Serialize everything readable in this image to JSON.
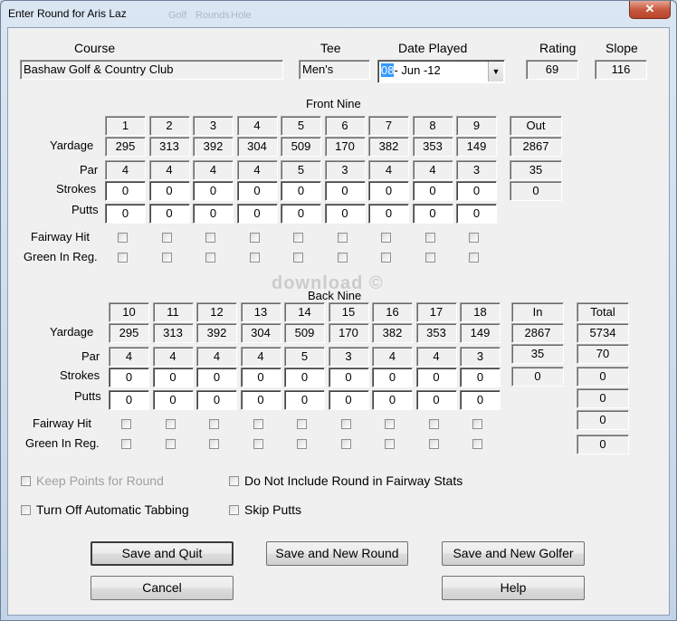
{
  "window": {
    "title": "Enter Round for Aris Laz",
    "close_glyph": "✕",
    "background_menu_ghost": [
      "Golf",
      "Rounds",
      "Hole"
    ]
  },
  "header": {
    "course_label": "Course",
    "course_value": "Bashaw Golf & Country Club",
    "tee_label": "Tee",
    "tee_value": "Men's",
    "date_label": "Date Played",
    "date_day": "08",
    "date_rest": "- Jun -12",
    "rating_label": "Rating",
    "rating_value": "69",
    "slope_label": "Slope",
    "slope_value": "116"
  },
  "front": {
    "title": "Front Nine",
    "holes": [
      "1",
      "2",
      "3",
      "4",
      "5",
      "6",
      "7",
      "8",
      "9"
    ],
    "yardage": [
      "295",
      "313",
      "392",
      "304",
      "509",
      "170",
      "382",
      "353",
      "149"
    ],
    "par": [
      "4",
      "4",
      "4",
      "4",
      "5",
      "3",
      "4",
      "4",
      "3"
    ],
    "strokes": [
      "0",
      "0",
      "0",
      "0",
      "0",
      "0",
      "0",
      "0",
      "0"
    ],
    "putts": [
      "0",
      "0",
      "0",
      "0",
      "0",
      "0",
      "0",
      "0",
      "0"
    ],
    "sum_label": "Out",
    "sum_yardage": "2867",
    "sum_par": "35",
    "sum_strokes": "0"
  },
  "back": {
    "title": "Back Nine",
    "holes": [
      "10",
      "11",
      "12",
      "13",
      "14",
      "15",
      "16",
      "17",
      "18"
    ],
    "yardage": [
      "295",
      "313",
      "392",
      "304",
      "509",
      "170",
      "382",
      "353",
      "149"
    ],
    "par": [
      "4",
      "4",
      "4",
      "4",
      "5",
      "3",
      "4",
      "4",
      "3"
    ],
    "strokes": [
      "0",
      "0",
      "0",
      "0",
      "0",
      "0",
      "0",
      "0",
      "0"
    ],
    "putts": [
      "0",
      "0",
      "0",
      "0",
      "0",
      "0",
      "0",
      "0",
      "0"
    ],
    "sum_label": "In",
    "sum_yardage": "2867",
    "sum_par": "35",
    "sum_strokes": "0",
    "total_label": "Total",
    "total_yardage": "5734",
    "total_par": "70",
    "total_strokes": "0",
    "total_putts": "0",
    "total_fairway": "0",
    "total_gir": "0"
  },
  "row_labels": {
    "yardage": "Yardage",
    "par": "Par",
    "strokes": "Strokes",
    "putts": "Putts",
    "fairway": "Fairway Hit",
    "gir": "Green In Reg."
  },
  "options": {
    "keep_points": "Keep Points for Round",
    "no_fairway_stats": "Do Not Include Round in Fairway Stats",
    "auto_tab": "Turn Off Automatic Tabbing",
    "skip_putts": "Skip Putts"
  },
  "buttons": {
    "save_quit": "Save and Quit",
    "save_new_round": "Save and New Round",
    "save_new_golfer": "Save and New Golfer",
    "cancel": "Cancel",
    "help": "Help"
  },
  "watermark": "download ©"
}
